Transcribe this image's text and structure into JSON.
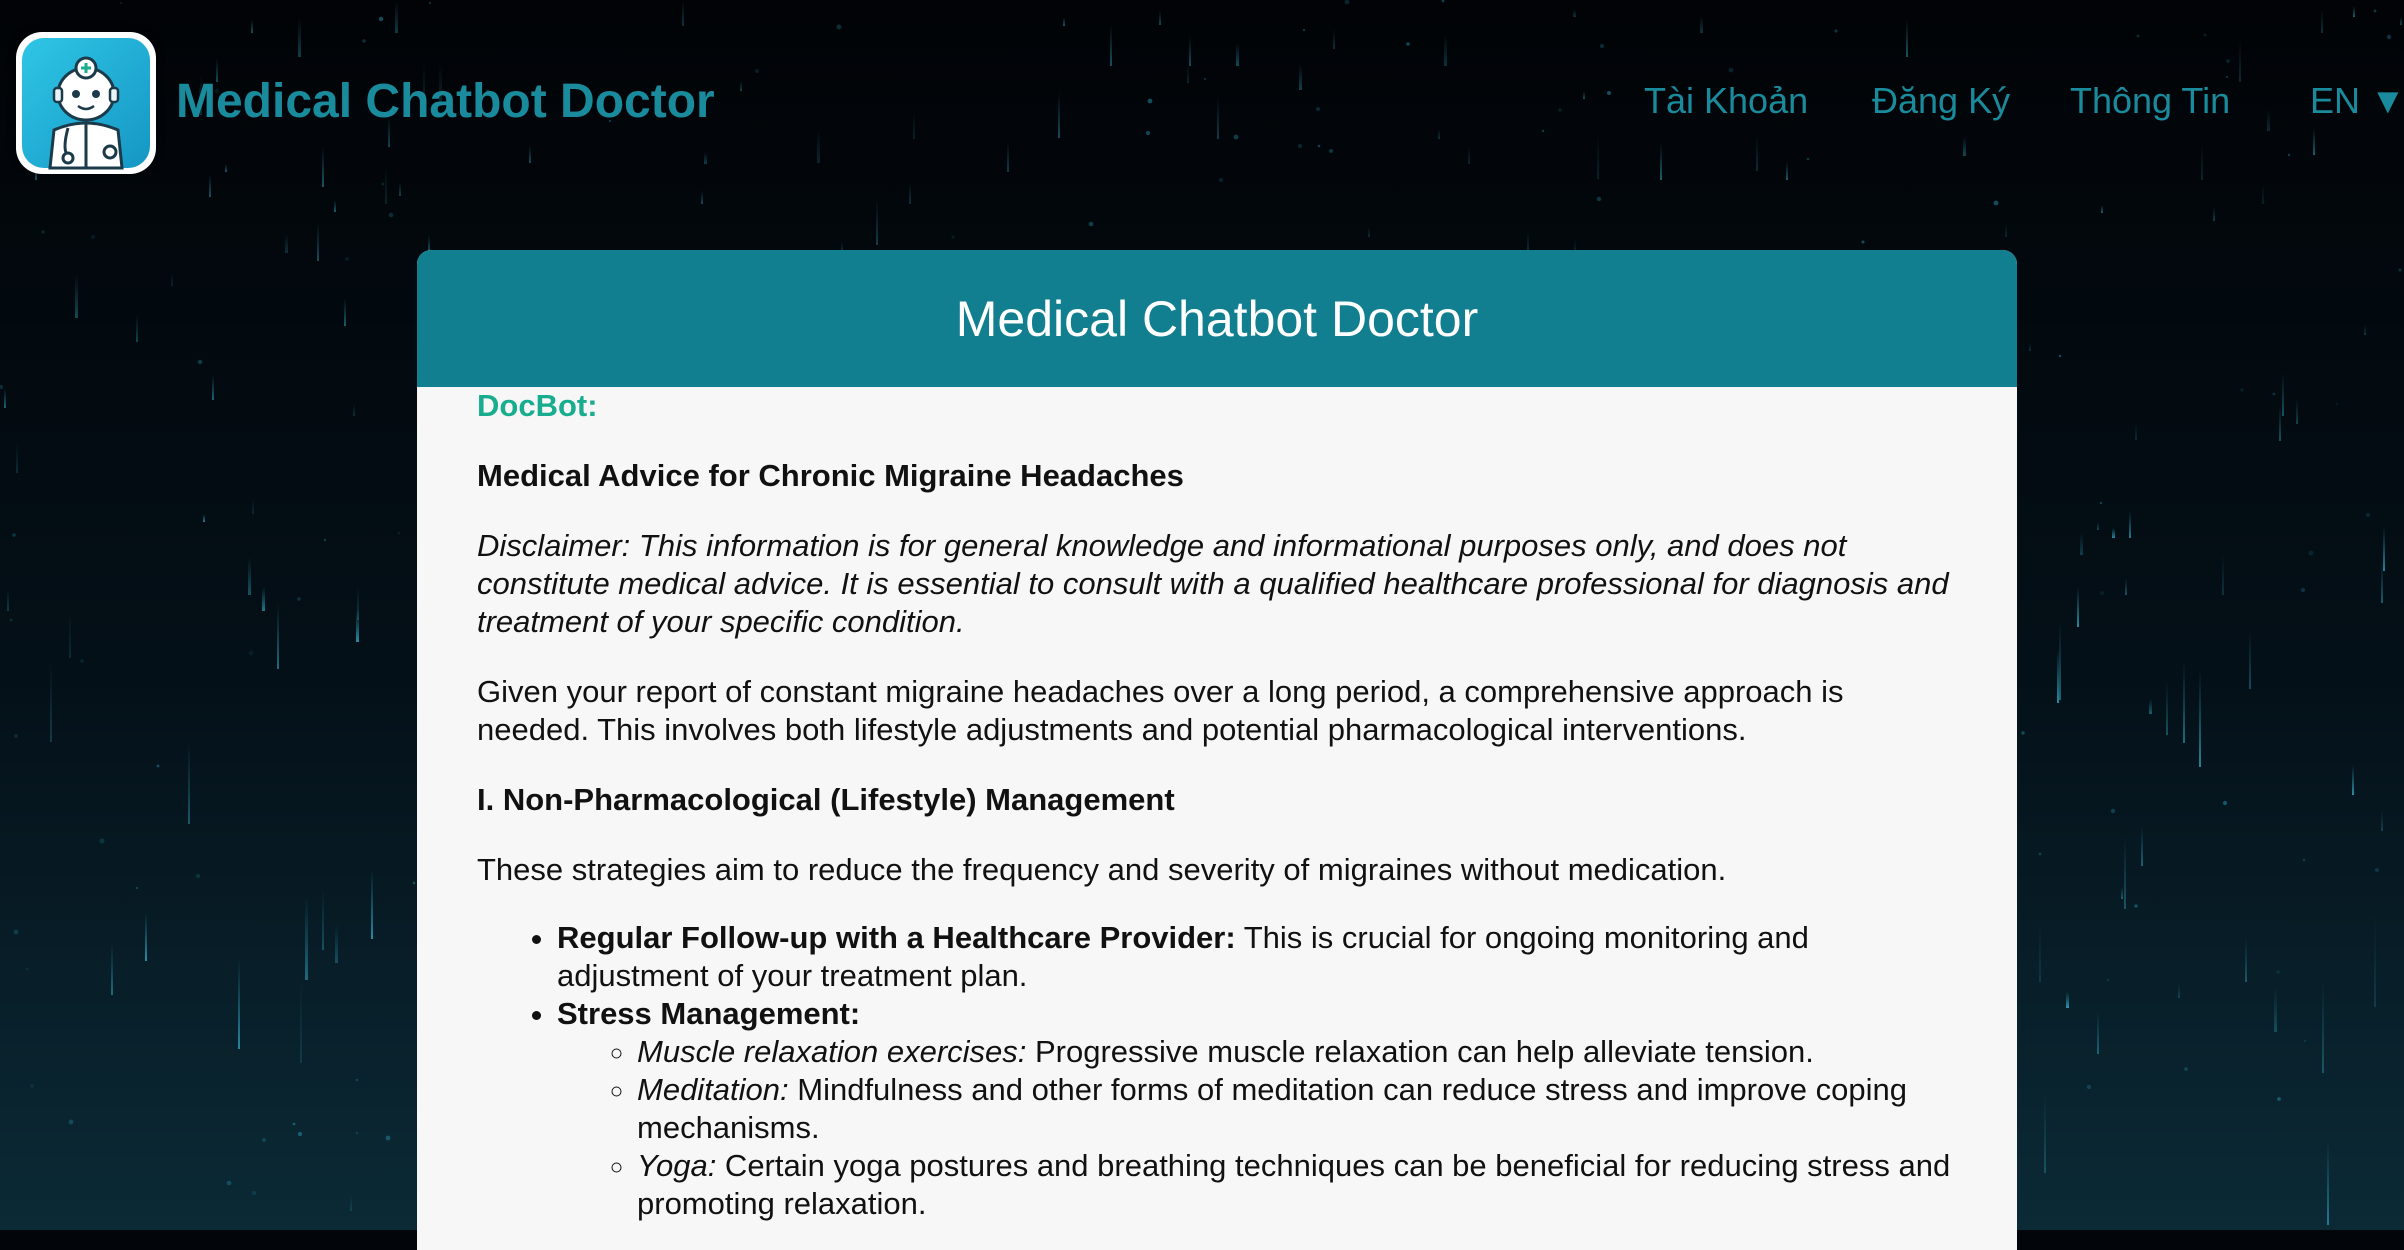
{
  "header": {
    "brand": "Medical Chatbot Doctor",
    "nav": {
      "account": "Tài Khoản",
      "register": "Đăng Ký",
      "info": "Thông Tin",
      "language": "EN ▼"
    }
  },
  "chat": {
    "title": "Medical Chatbot Doctor",
    "sender": "DocBot:",
    "message": {
      "heading": "Medical Advice for Chronic Migraine Headaches",
      "disclaimer": "Disclaimer: This information is for general knowledge and informational purposes only, and does not constitute medical advice. It is essential to consult with a qualified healthcare professional for diagnosis and treatment of your specific condition.",
      "intro": "Given your report of constant migraine headaches over a long period, a comprehensive approach is needed. This involves both lifestyle adjustments and potential pharmacological interventions.",
      "section1_title": "I. Non-Pharmacological (Lifestyle) Management",
      "section1_intro": "These strategies aim to reduce the frequency and severity of migraines without medication.",
      "items": [
        {
          "label": "Regular Follow-up with a Healthcare Provider:",
          "text": " This is crucial for ongoing monitoring and adjustment of your treatment plan."
        },
        {
          "label": "Stress Management:",
          "text": "",
          "subitems": [
            {
              "label": "Muscle relaxation exercises:",
              "text": " Progressive muscle relaxation can help alleviate tension."
            },
            {
              "label": "Meditation:",
              "text": " Mindfulness and other forms of meditation can reduce stress and improve coping mechanisms."
            },
            {
              "label": "Yoga:",
              "text": " Certain yoga postures and breathing techniques can be beneficial for reducing stress and promoting relaxation."
            }
          ]
        }
      ]
    }
  },
  "colors": {
    "brand_teal": "#1a8b9c",
    "header_teal": "#117f8f",
    "sender_green": "#19ad8f",
    "card_bg": "#f7f7f7"
  },
  "icons": {
    "logo": "robot-doctor-icon"
  }
}
